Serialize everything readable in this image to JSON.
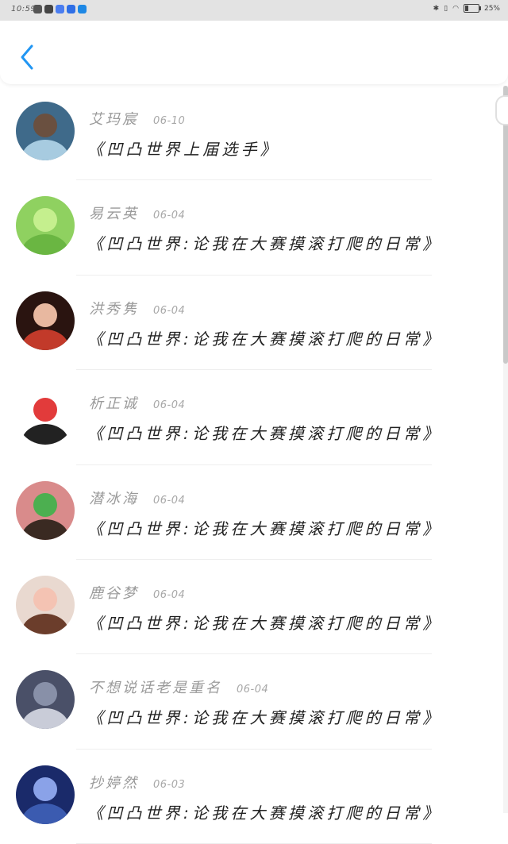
{
  "status_bar": {
    "time": "10:59",
    "battery_text": "25%",
    "battery_level": 0.25,
    "app_icon_colors": [
      "#555555",
      "#444444",
      "#4a7df0",
      "#2f6fe6",
      "#1e88e5"
    ]
  },
  "header": {
    "back_icon": "chevron-left-icon",
    "accent": "#2196f3"
  },
  "comments": [
    {
      "name": "艾玛宸",
      "date": "06-10",
      "text": "《凹凸世界上届选手》",
      "avatar_colors": [
        "#3f6a8a",
        "#a7cbe0",
        "#6a5040"
      ]
    },
    {
      "name": "易云英",
      "date": "06-04",
      "text": "《凹凸世界:论我在大赛摸滚打爬的日常》",
      "avatar_colors": [
        "#8fd160",
        "#6ab642",
        "#c5ef8e"
      ]
    },
    {
      "name": "洪秀隽",
      "date": "06-04",
      "text": "《凹凸世界:论我在大赛摸滚打爬的日常》",
      "avatar_colors": [
        "#2a1410",
        "#c23a2a",
        "#e8b8a0"
      ]
    },
    {
      "name": "析正诚",
      "date": "06-04",
      "text": "《凹凸世界:论我在大赛摸滚打爬的日常》",
      "avatar_colors": [
        "#ffffff",
        "#222222",
        "#e23b3b"
      ]
    },
    {
      "name": "潜冰海",
      "date": "06-04",
      "text": "《凹凸世界:论我在大赛摸滚打爬的日常》",
      "avatar_colors": [
        "#d98b8b",
        "#3a2a22",
        "#4caf50"
      ]
    },
    {
      "name": "鹿谷梦",
      "date": "06-04",
      "text": "《凹凸世界:论我在大赛摸滚打爬的日常》",
      "avatar_colors": [
        "#e9d9d0",
        "#6b3d2b",
        "#f4c3b3"
      ]
    },
    {
      "name": "不想说话老是重名",
      "date": "06-04",
      "text": "《凹凸世界:论我在大赛摸滚打爬的日常》",
      "avatar_colors": [
        "#4a5068",
        "#c9ccd8",
        "#8890a8"
      ]
    },
    {
      "name": "抄婷然",
      "date": "06-03",
      "text": "《凹凸世界:论我在大赛摸滚打爬的日常》",
      "avatar_colors": [
        "#1a2a6a",
        "#3b5bb0",
        "#8aa2e8"
      ]
    }
  ]
}
